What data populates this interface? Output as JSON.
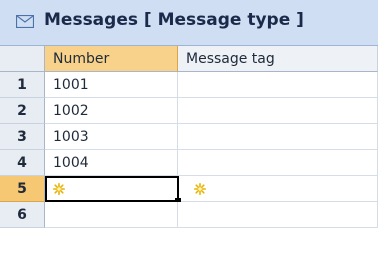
{
  "header": {
    "title": "Messages [ Message type ]",
    "icon": "mail-icon"
  },
  "columns": [
    {
      "label": "Number"
    },
    {
      "label": "Message tag"
    }
  ],
  "rows": [
    {
      "index": "1",
      "number": "1001",
      "tag": ""
    },
    {
      "index": "2",
      "number": "1002",
      "tag": ""
    },
    {
      "index": "3",
      "number": "1003",
      "tag": ""
    },
    {
      "index": "4",
      "number": "1004",
      "tag": ""
    },
    {
      "index": "5",
      "number": "",
      "tag": ""
    },
    {
      "index": "6",
      "number": "",
      "tag": ""
    }
  ],
  "new_row_icon": "new-value-star-icon",
  "colors": {
    "header_bg": "#cfdef3",
    "active_row_header": "#f7c873",
    "active_col_header": "#f8d28a",
    "cursor_border": "#000000"
  }
}
